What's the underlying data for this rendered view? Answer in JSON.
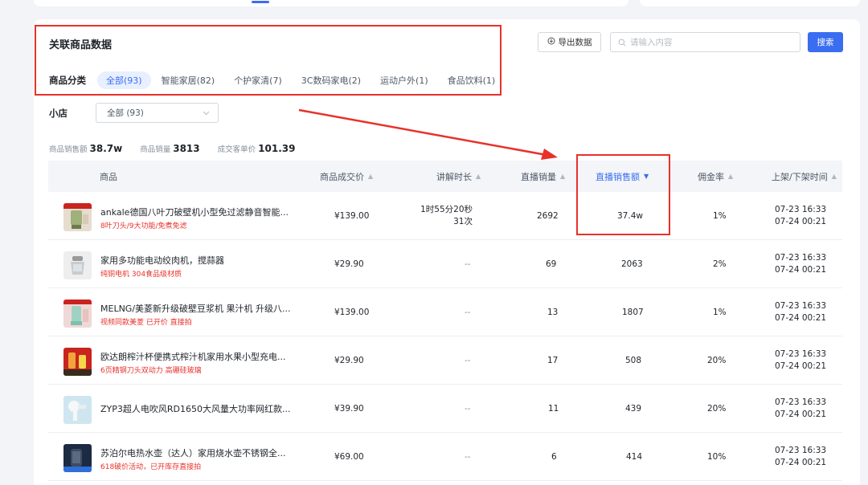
{
  "title": "关联商品数据",
  "category": {
    "label": "商品分类",
    "items": [
      {
        "label": "全部(93)",
        "active": true
      },
      {
        "label": "智能家居(82)",
        "active": false
      },
      {
        "label": "个护家清(7)",
        "active": false
      },
      {
        "label": "3C数码家电(2)",
        "active": false
      },
      {
        "label": "运动户外(1)",
        "active": false
      },
      {
        "label": "食品饮料(1)",
        "active": false
      }
    ]
  },
  "toolbar": {
    "export_label": "导出数据",
    "search_placeholder": "请输入内容",
    "search_label": "搜索"
  },
  "shop": {
    "label": "小店",
    "selected": "全部 (93)"
  },
  "stats": {
    "sales_amount_label": "商品销售额",
    "sales_amount": "38.7w",
    "sales_count_label": "商品销量",
    "sales_count": "3813",
    "unit_price_label": "成交客单价",
    "unit_price": "101.39"
  },
  "table": {
    "headers": {
      "product": "商品",
      "price": "商品成交价",
      "duration": "讲解时长",
      "live_sales": "直播销量",
      "live_amount": "直播销售额",
      "commission": "佣金率",
      "shelf_time": "上架/下架时间"
    },
    "rows": [
      {
        "name": "ankale德国八叶刀破壁机小型免过滤静音智能...",
        "tag": "8叶刀头/9大功能/免煮免滤",
        "price": "¥139.00",
        "duration": "1时55分20秒",
        "duration_count": "31次",
        "live_sales": "2692",
        "live_amount": "37.4w",
        "commission": "1%",
        "time_up": "07-23 16:33",
        "time_down": "07-24 00:21"
      },
      {
        "name": "家用多功能电动绞肉机，搅蒜器",
        "tag": "纯铜电机 304食品级材质",
        "price": "¥29.90",
        "duration": "--",
        "duration_count": "",
        "live_sales": "69",
        "live_amount": "2063",
        "commission": "2%",
        "time_up": "07-23 16:33",
        "time_down": "07-24 00:21"
      },
      {
        "name": "MELNG/美菱新升级破壁豆浆机 果汁机 升级八...",
        "tag": "视频同款美菱 已开价 直接拍",
        "price": "¥139.00",
        "duration": "--",
        "duration_count": "",
        "live_sales": "13",
        "live_amount": "1807",
        "commission": "1%",
        "time_up": "07-23 16:33",
        "time_down": "07-24 00:21"
      },
      {
        "name": "欧达朗榨汁杯便携式榨汁机家用水果小型充电...",
        "tag": "6页精钢刀头双动力 高硼硅玻璃",
        "price": "¥29.90",
        "duration": "--",
        "duration_count": "",
        "live_sales": "17",
        "live_amount": "508",
        "commission": "20%",
        "time_up": "07-23 16:33",
        "time_down": "07-24 00:21"
      },
      {
        "name": "ZYP3超人电吹风RD1650大风量大功率网红款...",
        "tag": "",
        "price": "¥39.90",
        "duration": "--",
        "duration_count": "",
        "live_sales": "11",
        "live_amount": "439",
        "commission": "20%",
        "time_up": "07-23 16:33",
        "time_down": "07-24 00:21"
      },
      {
        "name": "苏泊尔电热水壶（达人）家用烧水壶不锈钢全...",
        "tag": "618破价活动，已开库存直接拍",
        "price": "¥69.00",
        "duration": "--",
        "duration_count": "",
        "live_sales": "6",
        "live_amount": "414",
        "commission": "10%",
        "time_up": "07-23 16:33",
        "time_down": "07-24 00:21"
      }
    ]
  },
  "colors": {
    "accent": "#3a6df0",
    "highlight_red": "#e8312a"
  }
}
